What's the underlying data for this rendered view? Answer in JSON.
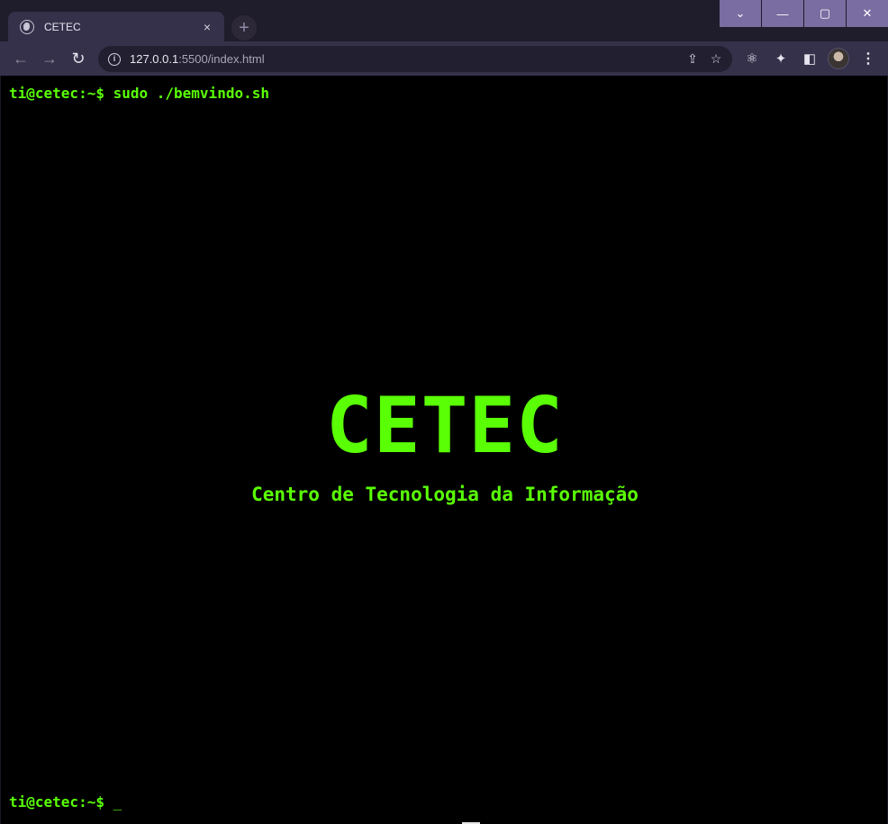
{
  "browser": {
    "tab": {
      "title": "CETEC",
      "favicon": "globe-icon",
      "close": "×"
    },
    "new_tab": "+",
    "window_controls": {
      "tabsearch": "⌄",
      "minimize": "—",
      "maximize": "▢",
      "close": "✕"
    },
    "toolbar": {
      "back": "←",
      "forward": "→",
      "reload": "↻",
      "url_host": "127.0.0.1",
      "url_path": ":5500/index.html",
      "share_icon": "⇪",
      "bookmark_icon": "☆",
      "react_icon": "⚛",
      "extensions_icon": "✦",
      "sidepanel_icon": "◧",
      "menu": "⋮"
    },
    "colors": {
      "accent": "#7a6da1",
      "toolbar": "#35314a",
      "titlebar": "#1f1c2b"
    }
  },
  "page": {
    "prompt_top": "ti@cetec:~$ sudo ./bemvindo.sh",
    "prompt_bottom": "ti@cetec:~$ ",
    "cursor": "_",
    "title": "CETEC",
    "subtitle": "Centro de Tecnologia da Informação",
    "colors": {
      "background": "#000000",
      "text": "#5aff06"
    }
  }
}
